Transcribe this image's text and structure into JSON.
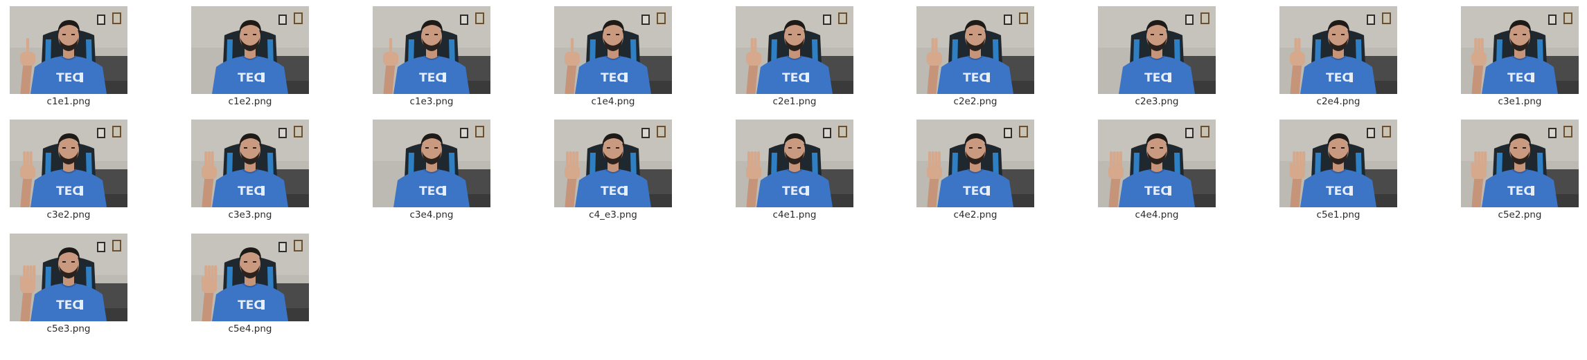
{
  "colors": {
    "background": "#ffffff",
    "label_text": "#2b2b2b"
  },
  "files": [
    {
      "name": "c1e1.png",
      "fingers": 1,
      "hand_side": "left",
      "icon": "image-thumbnail"
    },
    {
      "name": "c1e2.png",
      "fingers": 1,
      "hand_side": "right",
      "icon": "image-thumbnail"
    },
    {
      "name": "c1e3.png",
      "fingers": 1,
      "hand_side": "left",
      "icon": "image-thumbnail"
    },
    {
      "name": "c1e4.png",
      "fingers": 1,
      "hand_side": "left",
      "icon": "image-thumbnail"
    },
    {
      "name": "c2e1.png",
      "fingers": 2,
      "hand_side": "left",
      "icon": "image-thumbnail"
    },
    {
      "name": "c2e2.png",
      "fingers": 2,
      "hand_side": "left",
      "icon": "image-thumbnail"
    },
    {
      "name": "c2e3.png",
      "fingers": 2,
      "hand_side": "right",
      "icon": "image-thumbnail"
    },
    {
      "name": "c2e4.png",
      "fingers": 2,
      "hand_side": "left",
      "icon": "image-thumbnail"
    },
    {
      "name": "c3e1.png",
      "fingers": 3,
      "hand_side": "left",
      "icon": "image-thumbnail"
    },
    {
      "name": "c3e2.png",
      "fingers": 3,
      "hand_side": "left",
      "icon": "image-thumbnail"
    },
    {
      "name": "c3e3.png",
      "fingers": 3,
      "hand_side": "left",
      "icon": "image-thumbnail"
    },
    {
      "name": "c3e4.png",
      "fingers": 3,
      "hand_side": "right",
      "icon": "image-thumbnail"
    },
    {
      "name": "c4_e3.png",
      "fingers": 4,
      "hand_side": "left",
      "icon": "image-thumbnail"
    },
    {
      "name": "c4e1.png",
      "fingers": 4,
      "hand_side": "left",
      "icon": "image-thumbnail"
    },
    {
      "name": "c4e2.png",
      "fingers": 4,
      "hand_side": "left",
      "icon": "image-thumbnail"
    },
    {
      "name": "c4e4.png",
      "fingers": 4,
      "hand_side": "left",
      "icon": "image-thumbnail"
    },
    {
      "name": "c5e1.png",
      "fingers": 5,
      "hand_side": "left",
      "icon": "image-thumbnail"
    },
    {
      "name": "c5e2.png",
      "fingers": 5,
      "hand_side": "left",
      "icon": "image-thumbnail"
    },
    {
      "name": "c5e3.png",
      "fingers": 5,
      "hand_side": "left",
      "icon": "image-thumbnail"
    },
    {
      "name": "c5e4.png",
      "fingers": 5,
      "hand_side": "left",
      "icon": "image-thumbnail"
    }
  ]
}
